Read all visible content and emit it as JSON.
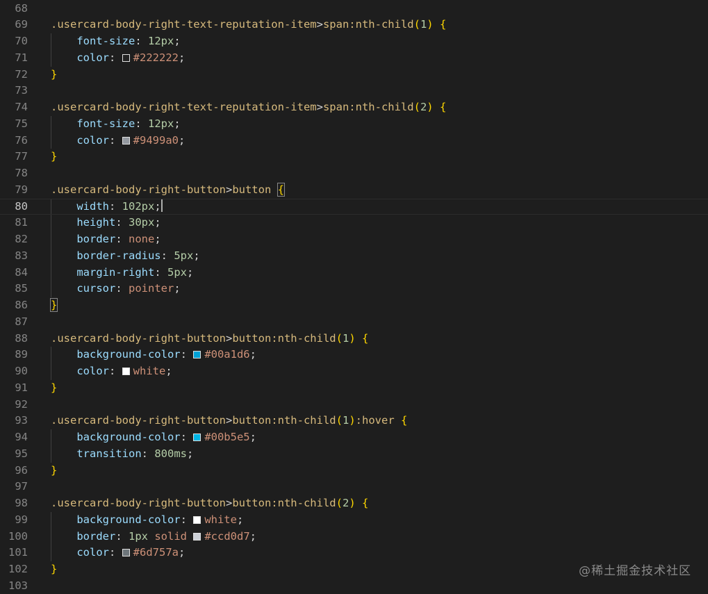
{
  "editor": {
    "language": "css",
    "current_line": "80",
    "lines": [
      {
        "num": "68"
      },
      {
        "num": "69",
        "selector": ".usercard-body-right-text-reputation-item",
        "combinator": ">",
        "target": "span:nth-child",
        "paren_open": "(",
        "arg": "1",
        "paren_close": ")",
        "space": " ",
        "brace": "{"
      },
      {
        "num": "70",
        "indent": "    ",
        "prop": "font-size",
        "colon": ": ",
        "value": "12px",
        "semi": ";"
      },
      {
        "num": "71",
        "indent": "    ",
        "prop": "color",
        "colon": ": ",
        "swatch_color": "#222222",
        "value": "#222222",
        "semi": ";"
      },
      {
        "num": "72",
        "brace": "}"
      },
      {
        "num": "73"
      },
      {
        "num": "74",
        "selector": ".usercard-body-right-text-reputation-item",
        "combinator": ">",
        "target": "span:nth-child",
        "paren_open": "(",
        "arg": "2",
        "paren_close": ")",
        "space": " ",
        "brace": "{"
      },
      {
        "num": "75",
        "indent": "    ",
        "prop": "font-size",
        "colon": ": ",
        "value": "12px",
        "semi": ";"
      },
      {
        "num": "76",
        "indent": "    ",
        "prop": "color",
        "colon": ": ",
        "swatch_color": "#9499a0",
        "value": "#9499a0",
        "semi": ";"
      },
      {
        "num": "77",
        "brace": "}"
      },
      {
        "num": "78"
      },
      {
        "num": "79",
        "selector": ".usercard-body-right-button",
        "combinator": ">",
        "target": "button",
        "space": " ",
        "brace": "{"
      },
      {
        "num": "80",
        "indent": "    ",
        "prop": "width",
        "colon": ": ",
        "value": "102px",
        "semi": ";"
      },
      {
        "num": "81",
        "indent": "    ",
        "prop": "height",
        "colon": ": ",
        "value": "30px",
        "semi": ";"
      },
      {
        "num": "82",
        "indent": "    ",
        "prop": "border",
        "colon": ": ",
        "value": "none",
        "semi": ";"
      },
      {
        "num": "83",
        "indent": "    ",
        "prop": "border-radius",
        "colon": ": ",
        "value": "5px",
        "semi": ";"
      },
      {
        "num": "84",
        "indent": "    ",
        "prop": "margin-right",
        "colon": ": ",
        "value": "5px",
        "semi": ";"
      },
      {
        "num": "85",
        "indent": "    ",
        "prop": "cursor",
        "colon": ": ",
        "value": "pointer",
        "semi": ";"
      },
      {
        "num": "86",
        "brace": "}"
      },
      {
        "num": "87"
      },
      {
        "num": "88",
        "selector": ".usercard-body-right-button",
        "combinator": ">",
        "target": "button:nth-child",
        "paren_open": "(",
        "arg": "1",
        "paren_close": ")",
        "space": " ",
        "brace": "{"
      },
      {
        "num": "89",
        "indent": "    ",
        "prop": "background-color",
        "colon": ": ",
        "swatch_color": "#00a1d6",
        "value": "#00a1d6",
        "semi": ";"
      },
      {
        "num": "90",
        "indent": "    ",
        "prop": "color",
        "colon": ": ",
        "swatch_color": "#ffffff",
        "value": "white",
        "semi": ";"
      },
      {
        "num": "91",
        "brace": "}"
      },
      {
        "num": "92"
      },
      {
        "num": "93",
        "selector": ".usercard-body-right-button",
        "combinator": ">",
        "target": "button:nth-child",
        "paren_open": "(",
        "arg": "1",
        "paren_close": ")",
        "pseudo": ":hover",
        "space": " ",
        "brace": "{"
      },
      {
        "num": "94",
        "indent": "    ",
        "prop": "background-color",
        "colon": ": ",
        "swatch_color": "#00b5e5",
        "value": "#00b5e5",
        "semi": ";"
      },
      {
        "num": "95",
        "indent": "    ",
        "prop": "transition",
        "colon": ": ",
        "value": "800ms",
        "semi": ";"
      },
      {
        "num": "96",
        "brace": "}"
      },
      {
        "num": "97"
      },
      {
        "num": "98",
        "selector": ".usercard-body-right-button",
        "combinator": ">",
        "target": "button:nth-child",
        "paren_open": "(",
        "arg": "2",
        "paren_close": ")",
        "space": " ",
        "brace": "{"
      },
      {
        "num": "99",
        "indent": "    ",
        "prop": "background-color",
        "colon": ": ",
        "swatch_color": "#ffffff",
        "value": "white",
        "semi": ";"
      },
      {
        "num": "100",
        "indent": "    ",
        "prop": "border",
        "colon": ": ",
        "value": "1px solid ",
        "swatch_color": "#ccd0d7",
        "value2": "#ccd0d7",
        "semi": ";"
      },
      {
        "num": "101",
        "indent": "    ",
        "prop": "color",
        "colon": ": ",
        "swatch_color": "#6d757a",
        "value": "#6d757a",
        "semi": ";"
      },
      {
        "num": "102",
        "brace": "}"
      },
      {
        "num": "103"
      }
    ]
  },
  "watermark": "@稀土掘金技术社区"
}
